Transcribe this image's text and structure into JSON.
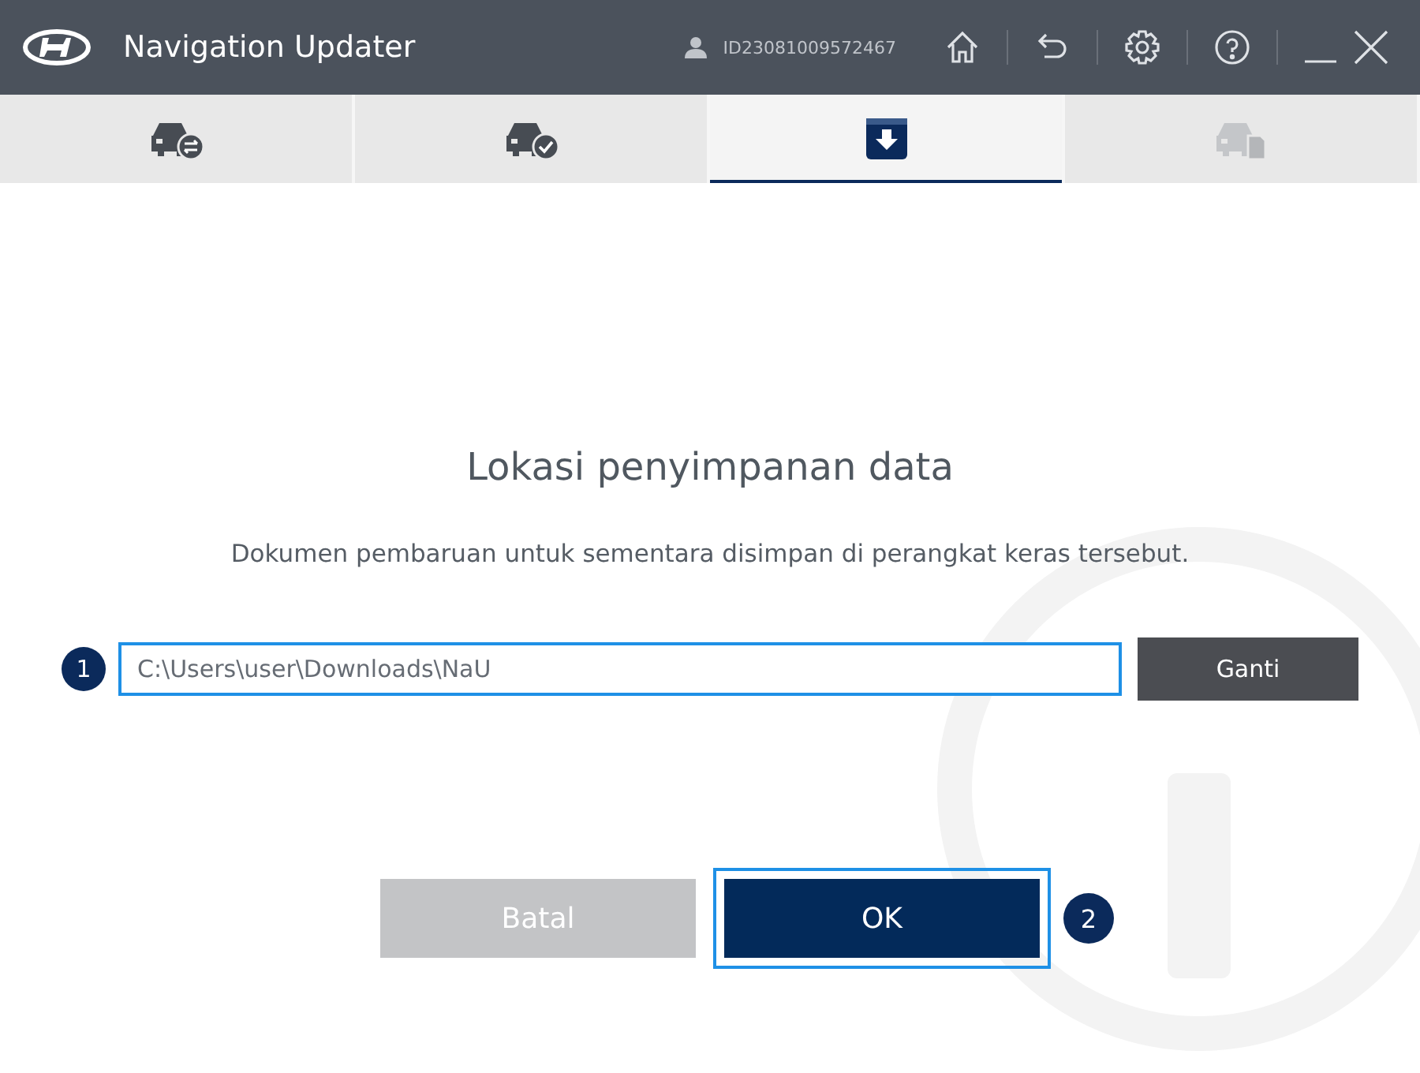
{
  "window": {
    "title": "Navigation Updater",
    "user_id": "ID23081009572467"
  },
  "steps": [
    {
      "kind": "car-sync",
      "selected": false,
      "disabled": false
    },
    {
      "kind": "car-check",
      "selected": false,
      "disabled": false
    },
    {
      "kind": "download",
      "selected": true,
      "disabled": false
    },
    {
      "kind": "car-card",
      "selected": false,
      "disabled": true
    }
  ],
  "dialog": {
    "title": "Lokasi penyimpanan data",
    "description": "Dokumen pembaruan untuk sementara disimpan di perangkat keras tersebut.",
    "path_field": {
      "callout": "1",
      "value": "C:\\Users\\user\\Downloads\\NaU",
      "focused": true
    },
    "change_button": "Ganti",
    "buttons": [
      {
        "label": "Batal",
        "disabled": true,
        "focused": false
      },
      {
        "label": "OK",
        "disabled": false,
        "focused": true,
        "callout": "2"
      }
    ]
  }
}
